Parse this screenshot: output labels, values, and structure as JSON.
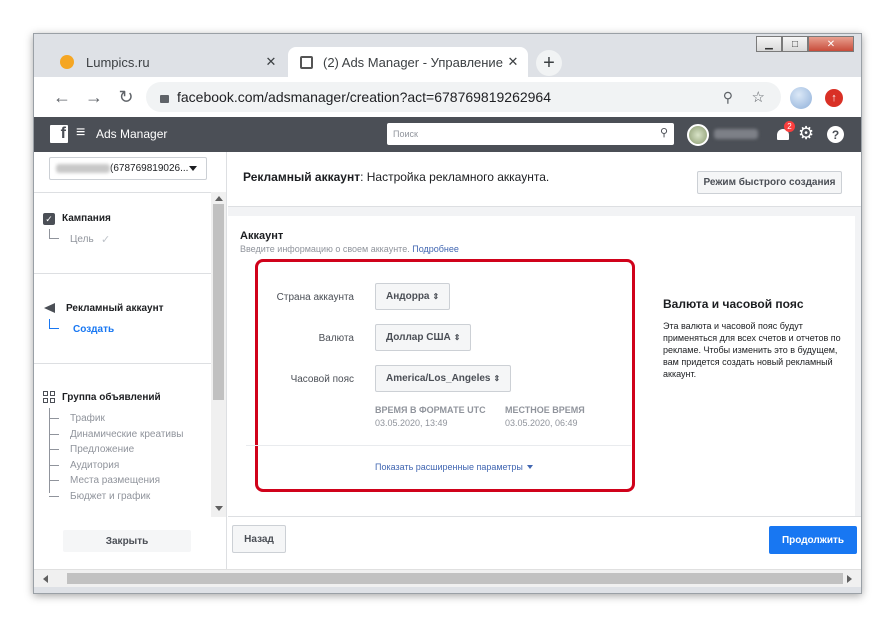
{
  "window": {
    "minimize": "▁",
    "maximize": "□",
    "close": "✕"
  },
  "tabs": [
    {
      "title": "Lumpics.ru",
      "close": "✕"
    },
    {
      "title": "(2) Ads Manager - Управление р",
      "close": "✕"
    }
  ],
  "new_tab": "+",
  "address": {
    "url": "facebook.com/adsmanager/creation?act=678769819262964"
  },
  "fb": {
    "logo": "f",
    "menu_icon": "≡",
    "title": "Ads Manager",
    "search_placeholder": "Поиск",
    "notif_count": "2",
    "help": "?"
  },
  "sidebar": {
    "account_selector": "(678769819026...",
    "campaign": "Кампания",
    "goal": "Цель",
    "ad_account": "Рекламный аккаунт",
    "create": "Создать",
    "ad_group": "Группа объявлений",
    "group_items": [
      "Трафик",
      "Динамические креативы",
      "Предложение",
      "Аудитория",
      "Места размещения",
      "Бюджет и график"
    ],
    "close_button": "Закрыть"
  },
  "main": {
    "header_title_bold": "Рекламный аккаунт",
    "header_title_rest": ": Настройка рекламного аккаунта.",
    "quick_mode_button": "Режим быстрого создания",
    "section_title": "Аккаунт",
    "section_subtitle": "Введите информацию о своем аккаунте.",
    "more_link": "Подробнее",
    "country_label": "Страна аккаунта",
    "country_value": "Андорра",
    "currency_label": "Валюта",
    "currency_value": "Доллар США",
    "timezone_label": "Часовой пояс",
    "timezone_value": "America/Los_Angeles",
    "utc_label": "ВРЕМЯ В ФОРМАТЕ UTC",
    "utc_value": "03.05.2020, 13:49",
    "local_label": "МЕСТНОЕ ВРЕМЯ",
    "local_value": "03.05.2020, 06:49",
    "advanced_link": "Показать расширенные параметры",
    "info_title": "Валюта и часовой пояс",
    "info_text": "Эта валюта и часовой пояс будут применяться для всех счетов и отчетов по рекламе. Чтобы изменить это в будущем, вам придется создать новый рекламный аккаунт.",
    "back_button": "Назад",
    "continue_button": "Продолжить"
  },
  "colors": {
    "fb_bar": "#4b4f56",
    "accent": "#1877f2",
    "highlight": "#d0021b",
    "link": "#4267b2"
  }
}
